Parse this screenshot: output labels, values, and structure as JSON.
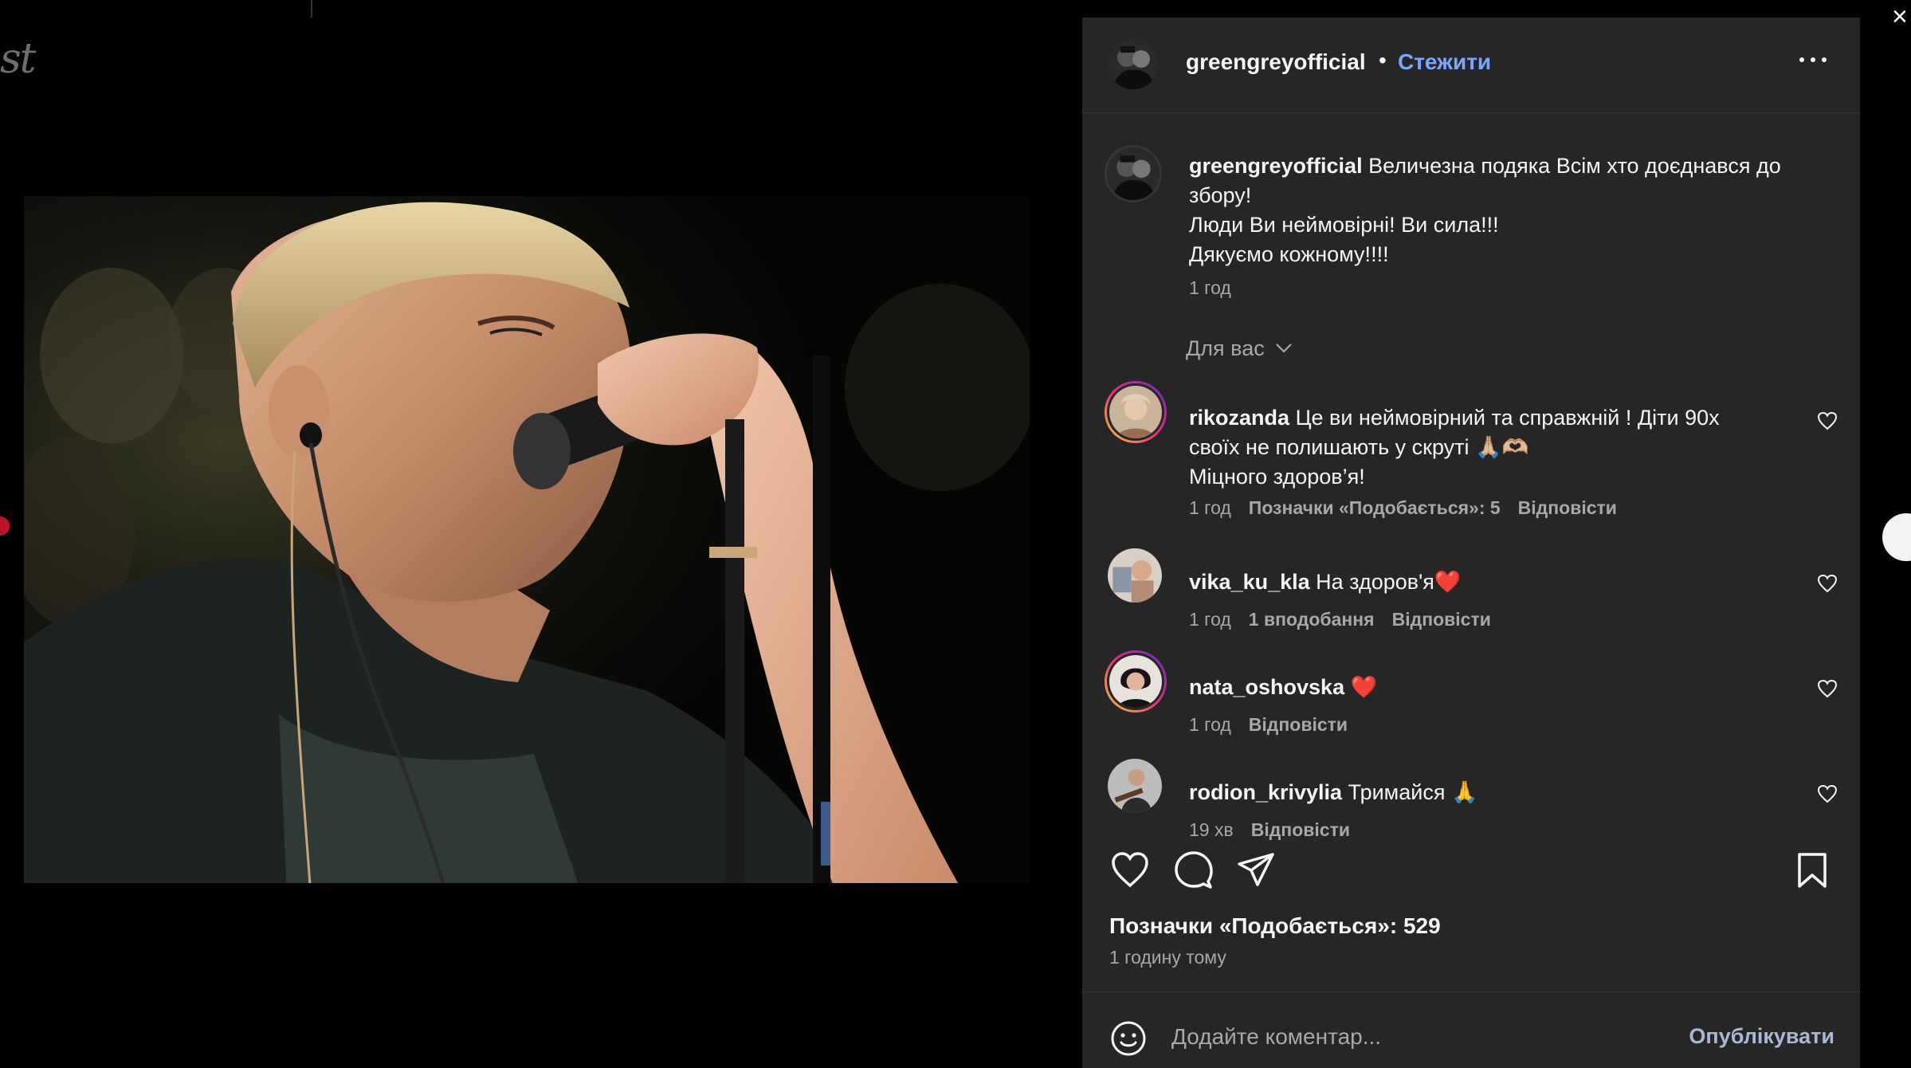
{
  "background": {
    "left_edge_text": "st"
  },
  "post": {
    "username": "greengreyofficial",
    "follow_label": "Стежити",
    "dot": "•",
    "caption_lines": [
      "Величезна подяка Всім хто доєднався до",
      "збору!",
      "Люди Ви неймовірні! Ви сила!!!",
      "Дякуємо кожному!!!!"
    ],
    "caption_time": "1 год",
    "likes_label": "Позначки «Подобається»: 529",
    "posted_ago": "1 годину тому"
  },
  "sort_label": "Для вас",
  "comments": [
    {
      "username": "rikozanda",
      "lines": [
        "Це ви неймовірний та справжній ! Діти 90х",
        "своїх не полишають у скруті 🙏🏼🫶🏼",
        "Міцного здоров’я!"
      ],
      "time": "1 год",
      "likes": "Позначки «Подобається»: 5",
      "reply": "Відповісти"
    },
    {
      "username": "vika_ku_kla",
      "lines": [
        "На здоров'я❤️"
      ],
      "time": "1 год",
      "likes": "1 вподобання",
      "reply": "Відповісти"
    },
    {
      "username": "nata_oshovska",
      "lines": [
        "❤️"
      ],
      "time": "1 год",
      "likes": "",
      "reply": "Відповісти"
    },
    {
      "username": "rodion_krivylia",
      "lines": [
        "Тримайся 🙏"
      ],
      "time": "19 хв",
      "likes": "",
      "reply": "Відповісти"
    }
  ],
  "comment_bar": {
    "placeholder": "Додайте коментар...",
    "publish": "Опублікувати"
  },
  "colors": {
    "panel_bg": "#262626",
    "link_blue": "#7aa6ff",
    "muted": "#a8a8a8"
  },
  "icons": [
    "more-icon",
    "heart-icon",
    "comment-icon",
    "share-icon",
    "bookmark-icon",
    "emoji-icon",
    "chevron-down-icon",
    "close-icon"
  ]
}
